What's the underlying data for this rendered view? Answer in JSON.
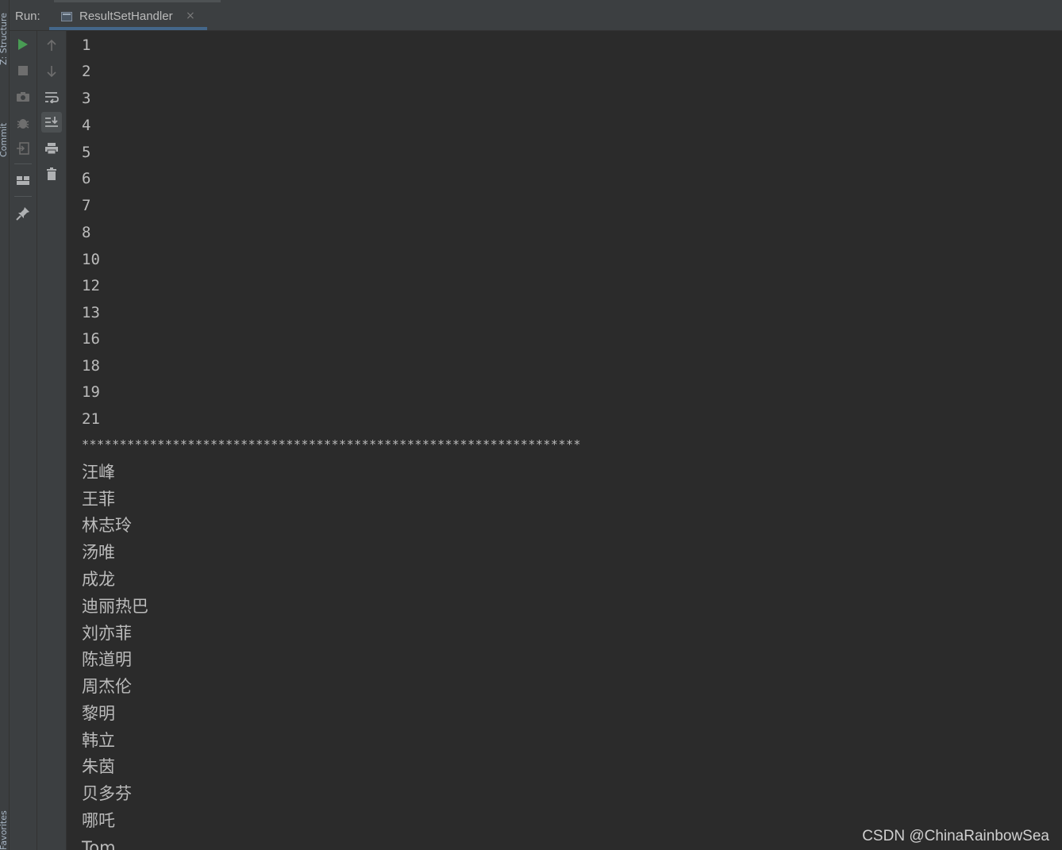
{
  "side_tabs": {
    "structure": "Z: Structure",
    "commit": "Commit",
    "favorites": "Favorites"
  },
  "header": {
    "run_label": "Run:",
    "tab_title": "ResultSetHandler",
    "close_glyph": "×"
  },
  "toolbar": {
    "left": [
      "rerun-icon",
      "stop-icon",
      "camera-icon",
      "debug-bug-icon",
      "exit-login-icon",
      "layout-icon",
      "pin-icon"
    ],
    "right": [
      "up-arrow-icon",
      "down-arrow-icon",
      "soft-wrap-icon",
      "scroll-to-end-icon",
      "print-icon",
      "trash-icon"
    ],
    "colors": {
      "rerun": "#499c54",
      "icon": "#afb1b3",
      "disabled": "#6e6e6e"
    }
  },
  "console": {
    "numbers": [
      "1",
      "2",
      "3",
      "4",
      "5",
      "6",
      "7",
      "8",
      "10",
      "12",
      "13",
      "16",
      "18",
      "19",
      "21"
    ],
    "separator": "******************************************************************",
    "names": [
      "汪峰",
      "王菲",
      "林志玲",
      "汤唯",
      "成龙",
      "迪丽热巴",
      "刘亦菲",
      "陈道明",
      "周杰伦",
      "黎明",
      "韩立",
      "朱茵",
      "贝多芬",
      "哪吒",
      "Tom"
    ]
  },
  "watermark": "CSDN @ChinaRainbowSea"
}
